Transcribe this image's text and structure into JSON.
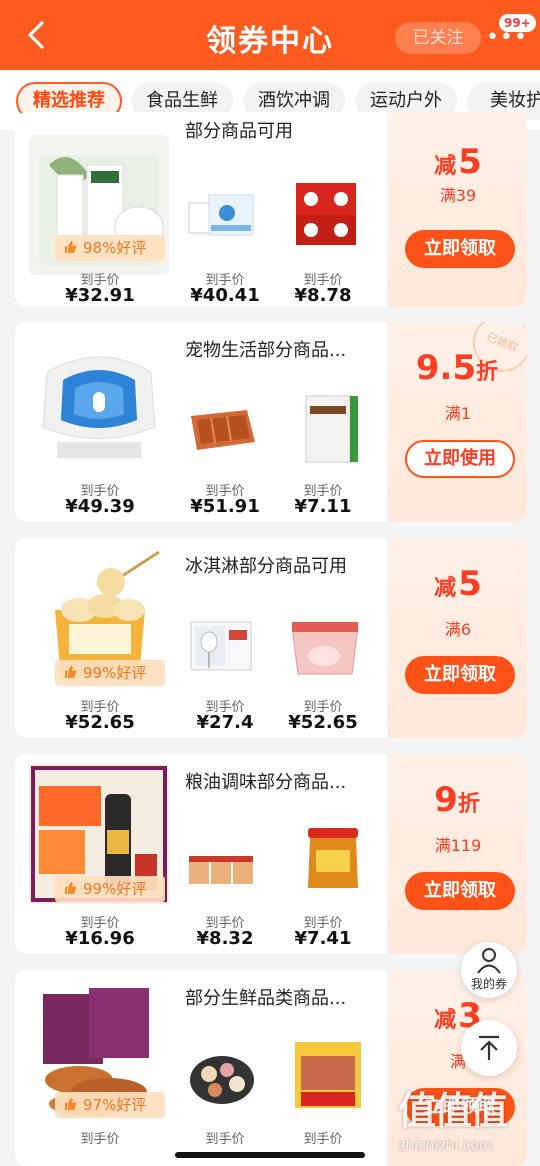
{
  "header": {
    "title": "领券中心",
    "follow_label": "已关注",
    "badge": "99+",
    "more": "•••"
  },
  "tabs": [
    "精选推荐",
    "食品生鲜",
    "酒饮冲调",
    "运动户外",
    "美妆护"
  ],
  "price_label": "到手价",
  "cards": [
    {
      "name": "部分商品可用",
      "rating": "98%好评",
      "prices": [
        "¥32.91",
        "¥40.41",
        "¥8.78"
      ],
      "discount_prefix": "减",
      "discount_value": "5",
      "discount_suffix": "",
      "condition": "满39",
      "button": "立即领取"
    },
    {
      "name": "宠物生活部分商品...",
      "rating": "",
      "prices": [
        "¥49.39",
        "¥51.91",
        "¥7.11"
      ],
      "discount_prefix": "",
      "discount_value": "9.5",
      "discount_suffix": "折",
      "condition": "满1",
      "button": "立即使用",
      "stamp": "已领取"
    },
    {
      "name": "冰淇淋部分商品可用",
      "rating": "99%好评",
      "prices": [
        "¥52.65",
        "¥27.4",
        "¥52.65"
      ],
      "discount_prefix": "减",
      "discount_value": "5",
      "discount_suffix": "",
      "condition": "满6",
      "button": "立即领取"
    },
    {
      "name": "粮油调味部分商品...",
      "rating": "99%好评",
      "prices": [
        "¥16.96",
        "¥8.32",
        "¥7.41"
      ],
      "discount_prefix": "",
      "discount_value": "9",
      "discount_suffix": "折",
      "condition": "满119",
      "button": "立即领取"
    },
    {
      "name": "部分生鲜品类商品...",
      "rating": "97%好评",
      "prices": [],
      "discount_prefix": "减",
      "discount_value": "3",
      "discount_suffix": "",
      "condition": "满",
      "button": "立即领取"
    }
  ],
  "float": {
    "my_coupons": "我的券"
  },
  "watermark": {
    "main": "值值值",
    "sub": "zhizhizhi.com"
  },
  "colors": {
    "brand": "#ff5b1f",
    "accent": "#ff3d22"
  }
}
